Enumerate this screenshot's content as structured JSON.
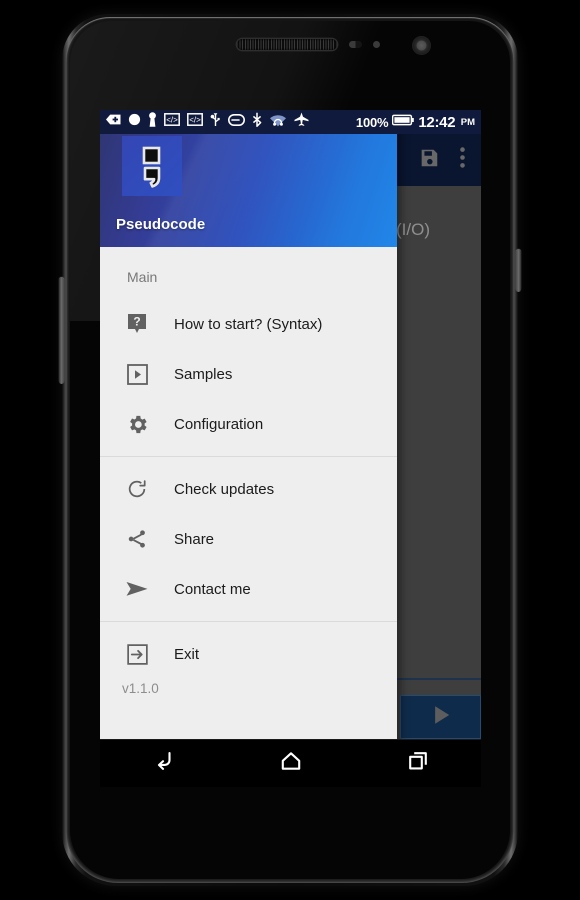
{
  "device": {
    "name": "android-phone-mockup",
    "hardware": {
      "earpiece": "earpiece-speaker",
      "front_camera": "front-camera",
      "proximity_sensor": "proximity-sensor",
      "light_sensor": "light-sensor",
      "volume_rocker": "volume-rocker",
      "power_button": "power-button"
    }
  },
  "status_bar": {
    "background": "#101a3c",
    "left_icons": [
      "back-arrow-icon",
      "circle-icon",
      "key-icon",
      "developer-code-icon",
      "developer-code-alt-icon",
      "usb-icon",
      "battery-saver-icon",
      "bluetooth-icon",
      "wifi-headphones-icon",
      "airplane-mode-icon"
    ],
    "battery_percent": "100%",
    "battery_icon": "battery-full-icon",
    "clock": "12:42",
    "clock_period": "PM"
  },
  "app_behind": {
    "action_bar": {
      "background": "#0f2048",
      "save_icon": "save-icon",
      "overflow_icon": "overflow-menu-icon"
    },
    "io_label": "(I/O)",
    "run_button": {
      "icon": "play-icon",
      "background": "#17406f",
      "border": "#3a6ea5"
    },
    "canvas_background": "#5c5c5c"
  },
  "drawer": {
    "header": {
      "app_name": "Pseudocode",
      "logo_icon": "semicolon-logo-icon",
      "gradient_from": "#2f3570",
      "gradient_to": "#2186e8"
    },
    "section_title": "Main",
    "groups": [
      {
        "items": [
          {
            "label": "How to start? (Syntax)",
            "icon": "help-question-icon"
          },
          {
            "label": "Samples",
            "icon": "play-box-icon"
          },
          {
            "label": "Configuration",
            "icon": "gear-icon"
          }
        ]
      },
      {
        "items": [
          {
            "label": "Check updates",
            "icon": "update-refresh-icon"
          },
          {
            "label": "Share",
            "icon": "share-icon"
          },
          {
            "label": "Contact me",
            "icon": "send-paper-plane-icon"
          }
        ]
      },
      {
        "items": [
          {
            "label": "Exit",
            "icon": "exit-logout-icon"
          }
        ]
      }
    ],
    "version": "v1.1.0",
    "background": "#eeeeee"
  },
  "android_nav_bar": {
    "buttons": [
      {
        "name": "back",
        "icon": "back-icon"
      },
      {
        "name": "home",
        "icon": "home-icon"
      },
      {
        "name": "recents",
        "icon": "recents-icon"
      }
    ]
  }
}
